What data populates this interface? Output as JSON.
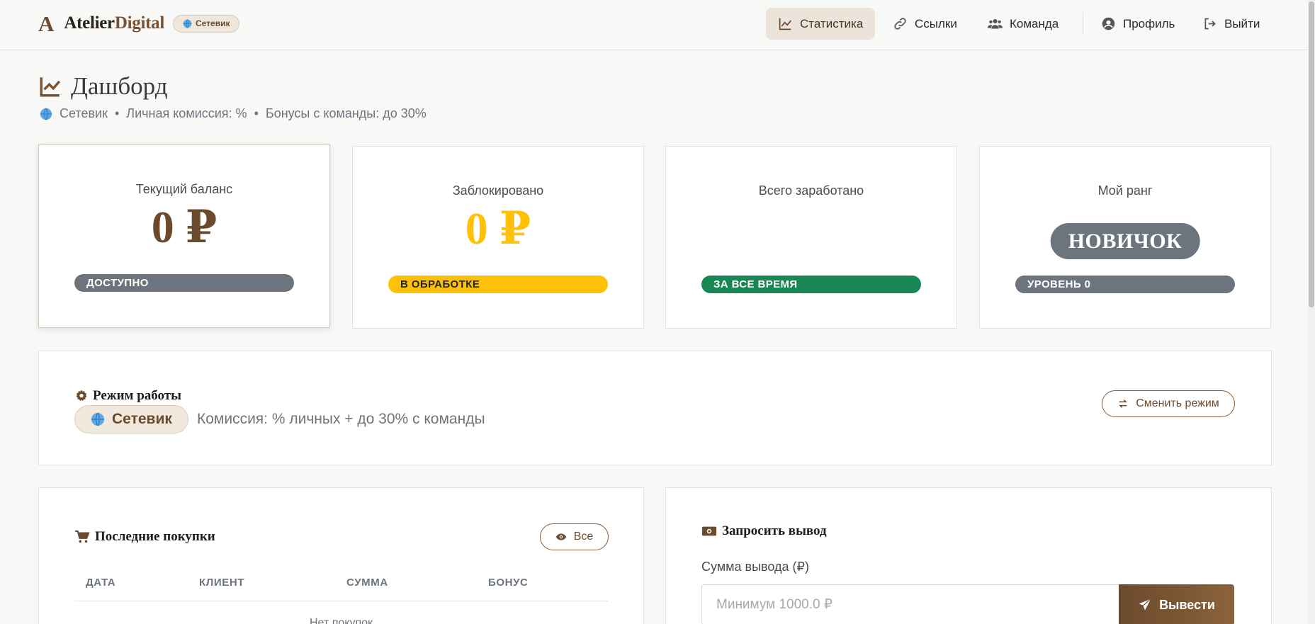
{
  "brand": {
    "logo_letter": "A",
    "name_part1": "Atelier",
    "name_part2": "Digital",
    "badge": "Сетевик"
  },
  "nav": {
    "stats": "Статистика",
    "links": "Ссылки",
    "team": "Команда",
    "profile": "Профиль",
    "logout": "Выйти"
  },
  "header": {
    "title": "Дашборд",
    "mode": "Сетевик",
    "commission": "Личная комиссия: %",
    "bonus": "Бонусы с команды: до 30%"
  },
  "stats": {
    "balance": {
      "label": "Текущий баланс",
      "value": "0 ₽",
      "pill": "ДОСТУПНО"
    },
    "blocked": {
      "label": "Заблокировано",
      "value": "0 ₽",
      "pill": "В ОБРАБОТКЕ"
    },
    "earned": {
      "label": "Всего заработано",
      "value": "",
      "pill": "ЗА ВСЕ ВРЕМЯ"
    },
    "rank": {
      "label": "Мой ранг",
      "value": "НОВИЧОК",
      "pill": "УРОВЕНЬ 0"
    }
  },
  "mode": {
    "title": "Режим работы",
    "current": "Сетевик",
    "description": "Комиссия: % личных + до 30% с команды",
    "change_button": "Сменить режим"
  },
  "purchases": {
    "title": "Последние покупки",
    "all_button": "Все",
    "columns": [
      "ДАТА",
      "КЛИЕНТ",
      "СУММА",
      "БОНУС"
    ],
    "empty": "Нет покупок"
  },
  "withdraw": {
    "title": "Запросить вывод",
    "amount_label": "Сумма вывода (₽)",
    "amount_placeholder": "Минимум 1000.0 ₽",
    "amount_value": "",
    "submit": "Вывести"
  },
  "colors": {
    "brand": "#6b4a2d",
    "accent_bg": "#ece4db",
    "gray": "#6c757d",
    "warning": "#ffc107",
    "success": "#198754"
  },
  "icons": {
    "stats": "chart-line-icon",
    "links": "link-icon",
    "team": "users-icon",
    "profile": "user-circle-icon",
    "logout": "sign-out-icon",
    "mode": "cog-icon",
    "swap": "exchange-icon",
    "cart": "shopping-cart-icon",
    "eye": "eye-icon",
    "money": "money-bill-icon",
    "send": "paper-plane-icon",
    "globe": "globe-icon"
  }
}
